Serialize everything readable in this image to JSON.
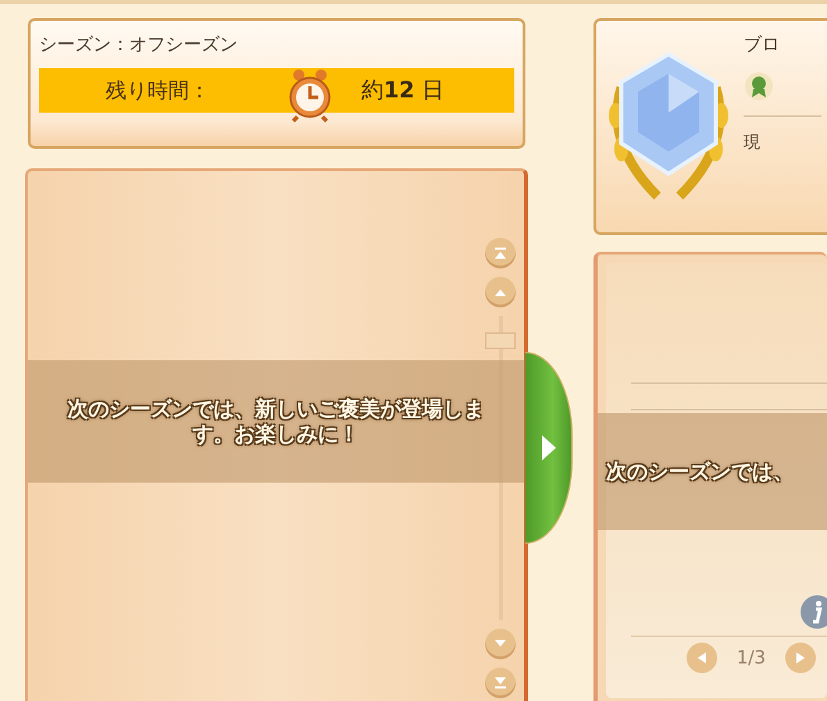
{
  "season": {
    "label": "シーズン：オフシーズン",
    "remaining_label": "残り時間：",
    "remaining_value": "約**12** 日"
  },
  "left_panel": {
    "message": "次のシーズンでは、新しいご褒美が登場します。お楽しみに！"
  },
  "rank_card": {
    "title": "ブロ",
    "current_label": "現"
  },
  "right_panel": {
    "message": "次のシーズンでは、",
    "page": "1/3"
  }
}
